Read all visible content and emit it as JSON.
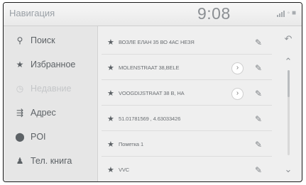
{
  "header": {
    "title": "Навигация",
    "time": "9:08",
    "status_glyphs": "◦ ■"
  },
  "sidebar": {
    "items": [
      {
        "label": "Поиск",
        "icon": "search-icon",
        "glyph": "⚲",
        "enabled": true
      },
      {
        "label": "Избранное",
        "icon": "star-icon",
        "glyph": "★",
        "enabled": true
      },
      {
        "label": "Недавние",
        "icon": "history-icon",
        "glyph": "◷",
        "enabled": false
      },
      {
        "label": "Адрес",
        "icon": "address-icon",
        "glyph": "⇶",
        "enabled": true
      },
      {
        "label": "POI",
        "icon": "pin-icon",
        "glyph": "⬤",
        "enabled": true
      },
      {
        "label": "Тел. книга",
        "icon": "person-icon",
        "glyph": "♟",
        "enabled": true
      }
    ]
  },
  "favorites": [
    {
      "name": "ВОЗЛЕ ЕЛАН 35 ВО 4АС НЕЗЯ",
      "has_more": false
    },
    {
      "name": "MOLENSTRAAT 38,BELE",
      "has_more": true
    },
    {
      "name": "VOOGDIJSTRAAT 38 B, HA",
      "has_more": true
    },
    {
      "name": "51.01781569 , 4.63033426",
      "has_more": false
    },
    {
      "name": "Пометка 1",
      "has_more": false
    },
    {
      "name": "VVC",
      "has_more": false
    }
  ],
  "icons": {
    "star": "★",
    "edit": "✎",
    "more": "›",
    "back": "↶",
    "up": "⌃",
    "down": "⌄"
  },
  "scroll": {
    "position": 0.0
  }
}
